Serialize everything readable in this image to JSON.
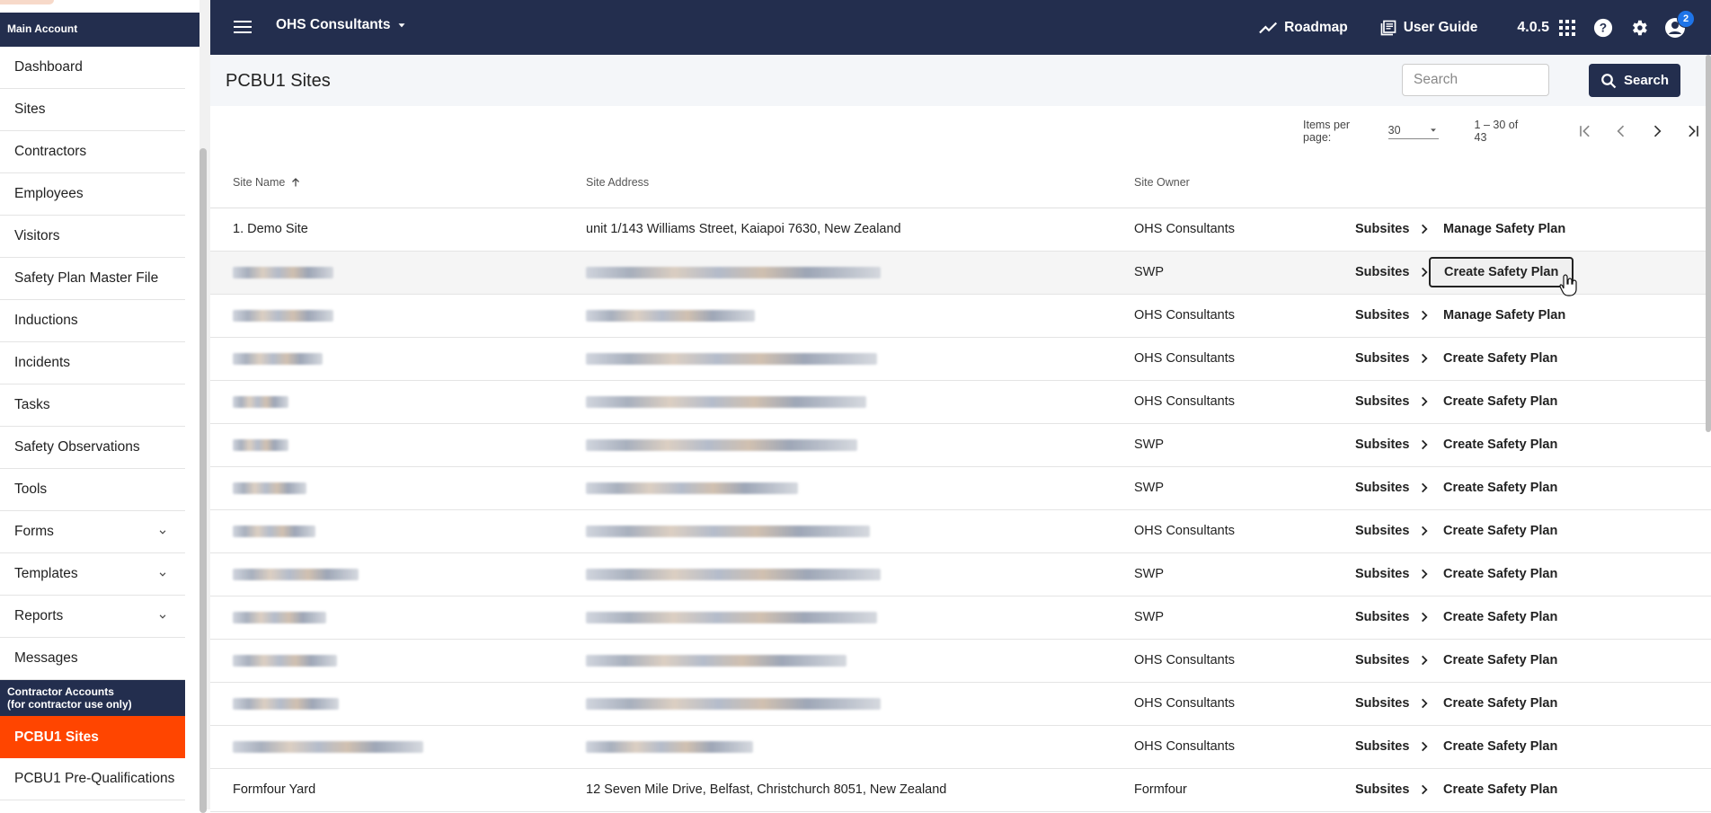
{
  "sidebar": {
    "main_section": "Main Account",
    "items": [
      {
        "label": "Dashboard"
      },
      {
        "label": "Sites"
      },
      {
        "label": "Contractors"
      },
      {
        "label": "Employees"
      },
      {
        "label": "Visitors"
      },
      {
        "label": "Safety Plan Master File"
      },
      {
        "label": "Inductions"
      },
      {
        "label": "Incidents"
      },
      {
        "label": "Tasks"
      },
      {
        "label": "Safety Observations"
      },
      {
        "label": "Tools"
      },
      {
        "label": "Forms"
      },
      {
        "label": "Templates"
      },
      {
        "label": "Reports"
      },
      {
        "label": "Messages"
      }
    ],
    "contractor_section_line1": "Contractor Accounts",
    "contractor_section_line2": "(for contractor use only)",
    "contractor_items": [
      {
        "label": "PCBU1 Sites"
      },
      {
        "label": "PCBU1 Pre-Qualifications"
      }
    ]
  },
  "topbar": {
    "org_name": "OHS Consultants",
    "roadmap": "Roadmap",
    "user_guide": "User Guide",
    "version": "4.0.5",
    "notification_count": "2"
  },
  "header": {
    "title": "PCBU1 Sites",
    "search_placeholder": "Search",
    "search_button": "Search"
  },
  "paginator": {
    "items_per_page_label": "Items per page:",
    "items_per_page": "30",
    "range": "1 – 30 of 43"
  },
  "table": {
    "columns": {
      "site_name": "Site Name",
      "site_address": "Site Address",
      "site_owner": "Site Owner"
    },
    "subsites_label": "Subsites",
    "rows": [
      {
        "name": "1. Demo Site",
        "address": "unit 1/143 Williams Street, Kaiapoi 7630, New Zealand",
        "owner": "OHS Consultants",
        "action": "Manage Safety Plan"
      },
      {
        "name": "",
        "address": "",
        "owner": "SWP",
        "action": "Create Safety Plan"
      },
      {
        "name": "",
        "address": "",
        "owner": "OHS Consultants",
        "action": "Manage Safety Plan"
      },
      {
        "name": "",
        "address": "",
        "owner": "OHS Consultants",
        "action": "Create Safety Plan"
      },
      {
        "name": "",
        "address": "",
        "owner": "OHS Consultants",
        "action": "Create Safety Plan"
      },
      {
        "name": "",
        "address": "",
        "owner": "SWP",
        "action": "Create Safety Plan"
      },
      {
        "name": "",
        "address": "",
        "owner": "SWP",
        "action": "Create Safety Plan"
      },
      {
        "name": "",
        "address": "",
        "owner": "OHS Consultants",
        "action": "Create Safety Plan"
      },
      {
        "name": "",
        "address": "",
        "owner": "SWP",
        "action": "Create Safety Plan"
      },
      {
        "name": "",
        "address": "",
        "owner": "SWP",
        "action": "Create Safety Plan"
      },
      {
        "name": "",
        "address": "",
        "owner": "OHS Consultants",
        "action": "Create Safety Plan"
      },
      {
        "name": "",
        "address": "",
        "owner": "OHS Consultants",
        "action": "Create Safety Plan"
      },
      {
        "name": "",
        "address": "",
        "owner": "OHS Consultants",
        "action": "Create Safety Plan"
      },
      {
        "name": "Formfour Yard",
        "address": "12 Seven Mile Drive, Belfast, Christchurch 8051, New Zealand",
        "owner": "Formfour",
        "action": "Create Safety Plan"
      }
    ]
  },
  "colors": {
    "navy": "#232e4e",
    "active_orange": "#ff4500",
    "badge_blue": "#1e74e8"
  }
}
